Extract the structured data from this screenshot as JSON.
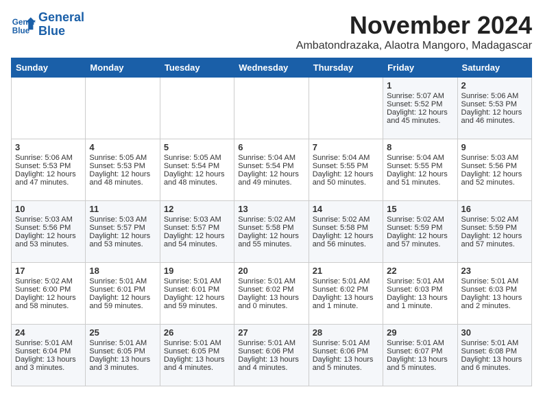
{
  "header": {
    "logo_line1": "General",
    "logo_line2": "Blue",
    "month_title": "November 2024",
    "location": "Ambatondrazaka, Alaotra Mangoro, Madagascar"
  },
  "weekdays": [
    "Sunday",
    "Monday",
    "Tuesday",
    "Wednesday",
    "Thursday",
    "Friday",
    "Saturday"
  ],
  "weeks": [
    [
      {
        "day": "",
        "empty": true
      },
      {
        "day": "",
        "empty": true
      },
      {
        "day": "",
        "empty": true
      },
      {
        "day": "",
        "empty": true
      },
      {
        "day": "",
        "empty": true
      },
      {
        "day": "1",
        "sunrise": "Sunrise: 5:07 AM",
        "sunset": "Sunset: 5:52 PM",
        "daylight": "Daylight: 12 hours and 45 minutes."
      },
      {
        "day": "2",
        "sunrise": "Sunrise: 5:06 AM",
        "sunset": "Sunset: 5:53 PM",
        "daylight": "Daylight: 12 hours and 46 minutes."
      }
    ],
    [
      {
        "day": "3",
        "sunrise": "Sunrise: 5:06 AM",
        "sunset": "Sunset: 5:53 PM",
        "daylight": "Daylight: 12 hours and 47 minutes."
      },
      {
        "day": "4",
        "sunrise": "Sunrise: 5:05 AM",
        "sunset": "Sunset: 5:53 PM",
        "daylight": "Daylight: 12 hours and 48 minutes."
      },
      {
        "day": "5",
        "sunrise": "Sunrise: 5:05 AM",
        "sunset": "Sunset: 5:54 PM",
        "daylight": "Daylight: 12 hours and 48 minutes."
      },
      {
        "day": "6",
        "sunrise": "Sunrise: 5:04 AM",
        "sunset": "Sunset: 5:54 PM",
        "daylight": "Daylight: 12 hours and 49 minutes."
      },
      {
        "day": "7",
        "sunrise": "Sunrise: 5:04 AM",
        "sunset": "Sunset: 5:55 PM",
        "daylight": "Daylight: 12 hours and 50 minutes."
      },
      {
        "day": "8",
        "sunrise": "Sunrise: 5:04 AM",
        "sunset": "Sunset: 5:55 PM",
        "daylight": "Daylight: 12 hours and 51 minutes."
      },
      {
        "day": "9",
        "sunrise": "Sunrise: 5:03 AM",
        "sunset": "Sunset: 5:56 PM",
        "daylight": "Daylight: 12 hours and 52 minutes."
      }
    ],
    [
      {
        "day": "10",
        "sunrise": "Sunrise: 5:03 AM",
        "sunset": "Sunset: 5:56 PM",
        "daylight": "Daylight: 12 hours and 53 minutes."
      },
      {
        "day": "11",
        "sunrise": "Sunrise: 5:03 AM",
        "sunset": "Sunset: 5:57 PM",
        "daylight": "Daylight: 12 hours and 53 minutes."
      },
      {
        "day": "12",
        "sunrise": "Sunrise: 5:03 AM",
        "sunset": "Sunset: 5:57 PM",
        "daylight": "Daylight: 12 hours and 54 minutes."
      },
      {
        "day": "13",
        "sunrise": "Sunrise: 5:02 AM",
        "sunset": "Sunset: 5:58 PM",
        "daylight": "Daylight: 12 hours and 55 minutes."
      },
      {
        "day": "14",
        "sunrise": "Sunrise: 5:02 AM",
        "sunset": "Sunset: 5:58 PM",
        "daylight": "Daylight: 12 hours and 56 minutes."
      },
      {
        "day": "15",
        "sunrise": "Sunrise: 5:02 AM",
        "sunset": "Sunset: 5:59 PM",
        "daylight": "Daylight: 12 hours and 57 minutes."
      },
      {
        "day": "16",
        "sunrise": "Sunrise: 5:02 AM",
        "sunset": "Sunset: 5:59 PM",
        "daylight": "Daylight: 12 hours and 57 minutes."
      }
    ],
    [
      {
        "day": "17",
        "sunrise": "Sunrise: 5:02 AM",
        "sunset": "Sunset: 6:00 PM",
        "daylight": "Daylight: 12 hours and 58 minutes."
      },
      {
        "day": "18",
        "sunrise": "Sunrise: 5:01 AM",
        "sunset": "Sunset: 6:01 PM",
        "daylight": "Daylight: 12 hours and 59 minutes."
      },
      {
        "day": "19",
        "sunrise": "Sunrise: 5:01 AM",
        "sunset": "Sunset: 6:01 PM",
        "daylight": "Daylight: 12 hours and 59 minutes."
      },
      {
        "day": "20",
        "sunrise": "Sunrise: 5:01 AM",
        "sunset": "Sunset: 6:02 PM",
        "daylight": "Daylight: 13 hours and 0 minutes."
      },
      {
        "day": "21",
        "sunrise": "Sunrise: 5:01 AM",
        "sunset": "Sunset: 6:02 PM",
        "daylight": "Daylight: 13 hours and 1 minute."
      },
      {
        "day": "22",
        "sunrise": "Sunrise: 5:01 AM",
        "sunset": "Sunset: 6:03 PM",
        "daylight": "Daylight: 13 hours and 1 minute."
      },
      {
        "day": "23",
        "sunrise": "Sunrise: 5:01 AM",
        "sunset": "Sunset: 6:03 PM",
        "daylight": "Daylight: 13 hours and 2 minutes."
      }
    ],
    [
      {
        "day": "24",
        "sunrise": "Sunrise: 5:01 AM",
        "sunset": "Sunset: 6:04 PM",
        "daylight": "Daylight: 13 hours and 3 minutes."
      },
      {
        "day": "25",
        "sunrise": "Sunrise: 5:01 AM",
        "sunset": "Sunset: 6:05 PM",
        "daylight": "Daylight: 13 hours and 3 minutes."
      },
      {
        "day": "26",
        "sunrise": "Sunrise: 5:01 AM",
        "sunset": "Sunset: 6:05 PM",
        "daylight": "Daylight: 13 hours and 4 minutes."
      },
      {
        "day": "27",
        "sunrise": "Sunrise: 5:01 AM",
        "sunset": "Sunset: 6:06 PM",
        "daylight": "Daylight: 13 hours and 4 minutes."
      },
      {
        "day": "28",
        "sunrise": "Sunrise: 5:01 AM",
        "sunset": "Sunset: 6:06 PM",
        "daylight": "Daylight: 13 hours and 5 minutes."
      },
      {
        "day": "29",
        "sunrise": "Sunrise: 5:01 AM",
        "sunset": "Sunset: 6:07 PM",
        "daylight": "Daylight: 13 hours and 5 minutes."
      },
      {
        "day": "30",
        "sunrise": "Sunrise: 5:01 AM",
        "sunset": "Sunset: 6:08 PM",
        "daylight": "Daylight: 13 hours and 6 minutes."
      }
    ]
  ]
}
